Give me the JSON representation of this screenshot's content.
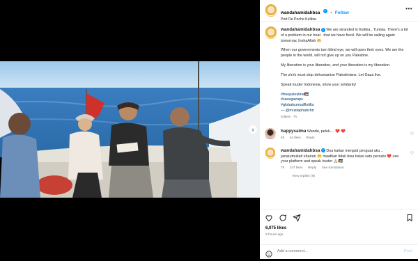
{
  "post": {
    "username": "wandahamidahbsa",
    "follow_label": "Follow",
    "separator": "•",
    "location": "Port De Peche Kelibia",
    "more_label": "•••"
  },
  "caption": {
    "username": "wandahamidahbsa",
    "p1": "We are stranded in Kelibia , Tunisia. There's a bit of a problem in our boat . that we have fixed. We will be sailing again tomorrow, InshaAllah 🤲",
    "p2": "When our governments turn blind eye, we will open their eyes. We are the people in the world, will not give up on you Palestine.",
    "p3": "My liberation is your liberation, and your liberation is my liberation.",
    "p4": "The z/n/s must stop dehumanise Palestinians. Let Gaza live.",
    "p5": "Speak louder Indonesia, show your solidarity!",
    "hashtags": [
      "#freepalestine🇵🇸",
      "#savegazaps",
      "#globalsumudflotilla"
    ],
    "mention": "— @mustaphabchn",
    "edited": "Edited · 7h"
  },
  "comments": [
    {
      "username": "happysalma",
      "text": "Wanda, peluk.... ❤️ ❤️",
      "time": "6h",
      "likes": "54 likes",
      "reply": "Reply"
    },
    {
      "username": "wandahamidahbsa",
      "text": "Doa kalian menjadi penguat aku .. jazakumullah khairan 🤲 maafkan tidak bisa balas satu persatu ❤️ use your platform and speak louder 🙏🇵🇸",
      "time": "7h",
      "likes": "247 likes",
      "reply": "Reply",
      "translation": "See translation",
      "view_replies": "View replies (9)"
    }
  ],
  "actions": {
    "likes": "6,075 likes",
    "time_ago": "9 hours ago"
  },
  "add_comment": {
    "placeholder": "Add a comment...",
    "post_label": "Post"
  },
  "colors": {
    "accent": "#0095f6",
    "link": "#00376b",
    "muted": "#737373",
    "heart": "#ed4956"
  }
}
